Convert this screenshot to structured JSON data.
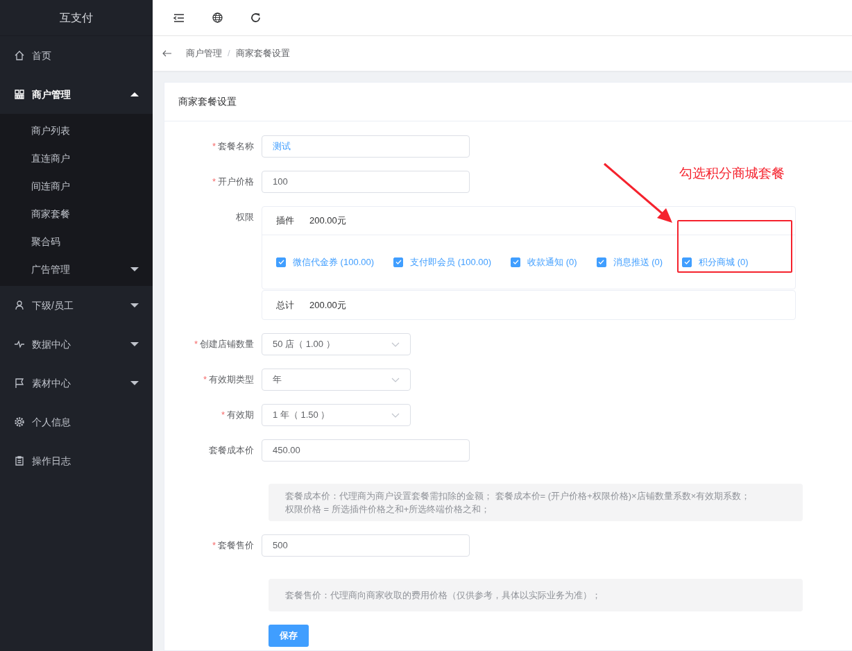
{
  "sidebar": {
    "brand": "互支付",
    "items": [
      {
        "label": "首页"
      },
      {
        "label": "商户管理",
        "expanded": true,
        "children": [
          {
            "label": "商户列表"
          },
          {
            "label": "直连商户"
          },
          {
            "label": "间连商户"
          },
          {
            "label": "商家套餐"
          },
          {
            "label": "聚合码"
          },
          {
            "label": "广告管理",
            "expanded": false
          }
        ]
      },
      {
        "label": "下级/员工",
        "expanded": false
      },
      {
        "label": "数据中心",
        "expanded": false
      },
      {
        "label": "素材中心",
        "expanded": false
      },
      {
        "label": "个人信息"
      },
      {
        "label": "操作日志"
      }
    ]
  },
  "breadcrumb": {
    "items": [
      "商户管理",
      "商家套餐设置"
    ],
    "separator": "/"
  },
  "card": {
    "title": "商家套餐设置"
  },
  "form": {
    "rows": [
      {
        "kind": "input",
        "label": "套餐名称",
        "marker": "*",
        "value": "测试",
        "accent": true
      },
      {
        "kind": "input",
        "label": "开户价格",
        "marker": "*",
        "value": "100"
      },
      {
        "kind": "permissions",
        "label": "权限",
        "header_label": "插件",
        "header_amount": "200.00元",
        "options": [
          {
            "label": "微信代金券 (100.00)",
            "checked": true
          },
          {
            "label": "支付即会员 (100.00)",
            "checked": true
          },
          {
            "label": "收款通知 (0)",
            "checked": true
          },
          {
            "label": "消息推送 (0)",
            "checked": true
          },
          {
            "label": "积分商城 (0)",
            "checked": true
          }
        ],
        "total_label": "总计",
        "total_amount": "200.00元"
      },
      {
        "kind": "select",
        "label": "创建店铺数量",
        "marker": "*",
        "value": "50 店（ 1.00 ）"
      },
      {
        "kind": "select",
        "label": "有效期类型",
        "marker": "*",
        "value": "年"
      },
      {
        "kind": "select",
        "label": "有效期",
        "marker": "*",
        "value": "1 年（ 1.50 ）"
      },
      {
        "kind": "input",
        "label": "套餐成本价",
        "value": "450.00"
      },
      {
        "kind": "note",
        "lines": [
          "套餐成本价：代理商为商户设置套餐需扣除的金额； 套餐成本价= (开户价格+权限价格)×店铺数量系数×有效期系数；",
          "权限价格 = 所选插件价格之和+所选终端价格之和；"
        ]
      },
      {
        "kind": "input",
        "label": "套餐售价",
        "marker": "*",
        "value": "500"
      },
      {
        "kind": "note",
        "lines": [
          "套餐售价：代理商向商家收取的费用价格（仅供参考，具体以实际业务为准）；"
        ]
      },
      {
        "kind": "button",
        "label": "保存"
      }
    ]
  },
  "annotation": {
    "text": "勾选积分商城套餐"
  }
}
